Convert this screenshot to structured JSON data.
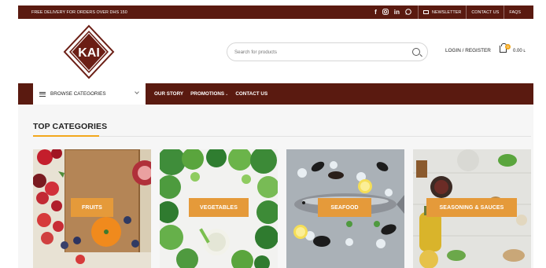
{
  "topbar": {
    "promo": "FREE DELIVERY FOR ORDERS OVER DHS 150",
    "social_icons": [
      "facebook-icon",
      "instagram-icon",
      "linkedin-icon",
      "whatsapp-icon"
    ],
    "newsletter": "NEWSLETTER",
    "contact": "CONTACT US",
    "faqs": "FAQS"
  },
  "header": {
    "logo_text": "KAI",
    "search_placeholder": "Search for products",
    "login": "LOGIN / REGISTER",
    "cart_count": "0",
    "cart_total": "0.00 ʟ"
  },
  "nav": {
    "browse": "BROWSE CATEGORIES",
    "links": [
      "OUR STORY",
      "PROMOTIONS",
      "CONTACT US"
    ]
  },
  "main": {
    "section_title": "TOP CATEGORIES",
    "categories": [
      "FRUITS",
      "VEGETABLES",
      "SEAFOOD",
      "SEASONING & SAUCES"
    ]
  },
  "colors": {
    "brand_maroon": "#5a1a10",
    "accent_orange": "#e59a3a",
    "badge_yellow": "#f2a71d"
  }
}
